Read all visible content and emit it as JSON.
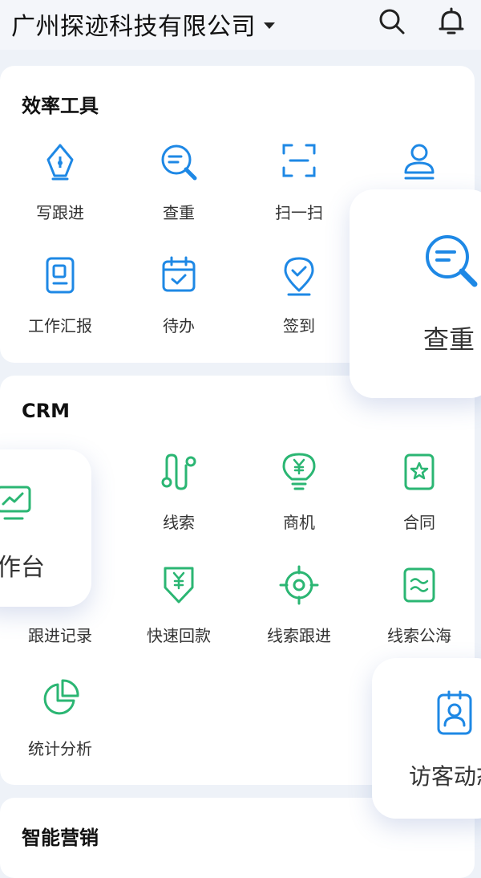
{
  "header": {
    "company": "广州探迹科技有限公司"
  },
  "sections": {
    "efficiency": {
      "title": "效率工具",
      "items": [
        "写跟进",
        "查重",
        "扫一扫",
        "工作汇报",
        "待办",
        "签到"
      ]
    },
    "crm": {
      "title": "CRM",
      "items": [
        "线索",
        "商机",
        "合同",
        "跟进记录",
        "快速回款",
        "线索跟进",
        "线索公海",
        "统计分析"
      ]
    },
    "marketing": {
      "title": "智能营销"
    }
  },
  "floating": {
    "duplicate": "查重",
    "workbench": "作台",
    "visitor": "访客动态"
  },
  "colors": {
    "blue": "#1e88e5",
    "green": "#2bb673",
    "bg": "#eef2f8"
  }
}
